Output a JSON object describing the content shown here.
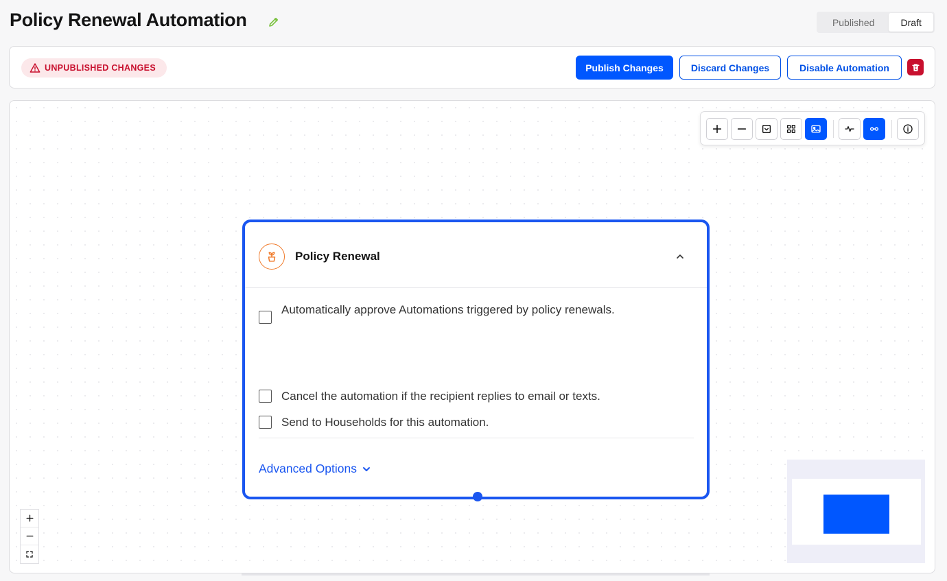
{
  "header": {
    "title": "Policy Renewal Automation",
    "edit_icon": "pencil-icon",
    "status_tabs": [
      {
        "label": "Published",
        "active": false
      },
      {
        "label": "Draft",
        "active": true
      }
    ]
  },
  "actions": {
    "badge_label": "UNPUBLISHED CHANGES",
    "badge_icon": "warning-triangle-icon",
    "publish_label": "Publish Changes",
    "discard_label": "Discard Changes",
    "disable_label": "Disable Automation",
    "delete_icon": "trash-icon"
  },
  "toolbar": {
    "buttons": [
      "zoom-in-icon",
      "zoom-out-icon",
      "dropdown-box-icon",
      "grid-icon",
      "image-icon",
      "activity-icon",
      "link-icon",
      "info-icon"
    ],
    "active": [
      "image-icon",
      "link-icon"
    ]
  },
  "node": {
    "title": "Policy Renewal",
    "icon": "plant-pot-icon",
    "options": [
      {
        "label": "Automatically approve Automations triggered by policy renewals.",
        "checked": false
      },
      {
        "label": "Cancel the automation if the recipient replies to email or texts.",
        "checked": false
      },
      {
        "label": "Send to Households for this automation.",
        "checked": false
      }
    ],
    "advanced_label": "Advanced Options"
  },
  "colors": {
    "primary": "#0057ff",
    "node_border": "#1a56f0",
    "danger": "#c8102e",
    "node_icon": "#f07a2a"
  }
}
